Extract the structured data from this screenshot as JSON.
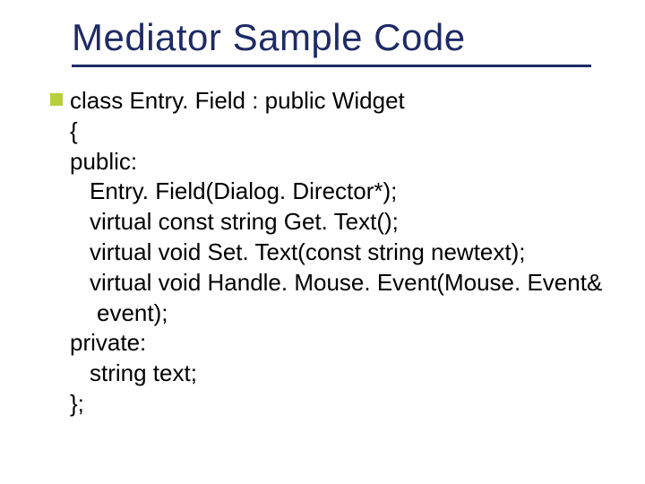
{
  "title": "Mediator Sample Code",
  "code": {
    "l1": "class Entry. Field : public Widget",
    "l2": "{",
    "l3": "public:",
    "l4": "Entry. Field(Dialog. Director*);",
    "l5": "virtual const string Get. Text();",
    "l6": "virtual void Set. Text(const string newtext);",
    "l7": "virtual void Handle. Mouse. Event(Mouse. Event&",
    "l8": "event);",
    "l9": "private:",
    "l10": "string text;",
    "l11": "};"
  }
}
